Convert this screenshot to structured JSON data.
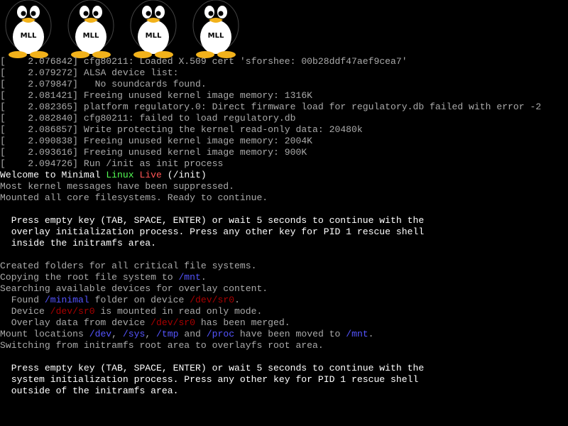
{
  "logos": [
    {
      "icon": "tux-penguin-icon",
      "label": "MLL"
    },
    {
      "icon": "tux-penguin-icon",
      "label": "MLL"
    },
    {
      "icon": "tux-penguin-icon",
      "label": "MLL"
    },
    {
      "icon": "tux-penguin-icon",
      "label": "MLL"
    }
  ],
  "colors": {
    "background": "#000000",
    "text": "#aaaaaa",
    "bright": "#ffffff",
    "linux": "#55ff55",
    "live": "#ff5555",
    "path": "#5555ff",
    "device": "#aa0000"
  },
  "kernel_log": [
    {
      "ts": "[    2.076842]",
      "msg": " cfg80211: Loaded X.509 cert 'sforshee: 00b28ddf47aef9cea7'"
    },
    {
      "ts": "[    2.079272]",
      "msg": " ALSA device list:"
    },
    {
      "ts": "[    2.079847]",
      "msg": "   No soundcards found."
    },
    {
      "ts": "[    2.081421]",
      "msg": " Freeing unused kernel image memory: 1316K"
    },
    {
      "ts": "[    2.082365]",
      "msg": " platform regulatory.0: Direct firmware load for regulatory.db failed with error -2"
    },
    {
      "ts": "[    2.082840]",
      "msg": " cfg80211: failed to load regulatory.db"
    },
    {
      "ts": "[    2.086857]",
      "msg": " Write protecting the kernel read-only data: 20480k"
    },
    {
      "ts": "[    2.090838]",
      "msg": " Freeing unused kernel image memory: 2004K"
    },
    {
      "ts": "[    2.093616]",
      "msg": " Freeing unused kernel image memory: 900K"
    },
    {
      "ts": "[    2.094726]",
      "msg": " Run /init as init process"
    }
  ],
  "welcome": {
    "prefix": "Welcome to ",
    "minimal": "Minimal",
    "linux": "Linux",
    "live": "Live",
    "suffix": " (/init)"
  },
  "messages": {
    "suppressed": "Most kernel messages have been suppressed.",
    "mounted": "Mounted all core filesystems. Ready to continue."
  },
  "prompt1": [
    "  Press empty key (TAB, SPACE, ENTER) or wait 5 seconds to continue with the",
    "  overlay initialization process. Press any other key for PID 1 rescue shell",
    "  inside the initramfs area."
  ],
  "overlay": {
    "created": "Created folders for all critical file systems.",
    "copying_pre": "Copying the root file system to ",
    "copying_path": "/mnt",
    "copying_post": ".",
    "searching": "Searching available devices for overlay content.",
    "found_pre": "  Found ",
    "found_path": "/minimal",
    "found_mid": " folder on device ",
    "found_dev": "/dev/sr0",
    "found_post": ".",
    "device_pre": "  Device ",
    "device_dev": "/dev/sr0",
    "device_post": " is mounted in read only mode.",
    "data_pre": "  Overlay data from device ",
    "data_dev": "/dev/sr0",
    "data_post": " has been merged.",
    "mount_pre": "Mount locations ",
    "mount_dev": "/dev",
    "mount_sep1": ", ",
    "mount_sys": "/sys",
    "mount_sep2": ", ",
    "mount_tmp": "/tmp",
    "mount_and": " and ",
    "mount_proc": "/proc",
    "mount_mid": " have been moved to ",
    "mount_mnt": "/mnt",
    "mount_post": ".",
    "switching": "Switching from initramfs root area to overlayfs root area."
  },
  "prompt2": [
    "  Press empty key (TAB, SPACE, ENTER) or wait 5 seconds to continue with the",
    "  system initialization process. Press any other key for PID 1 rescue shell",
    "  outside of the initramfs area."
  ]
}
